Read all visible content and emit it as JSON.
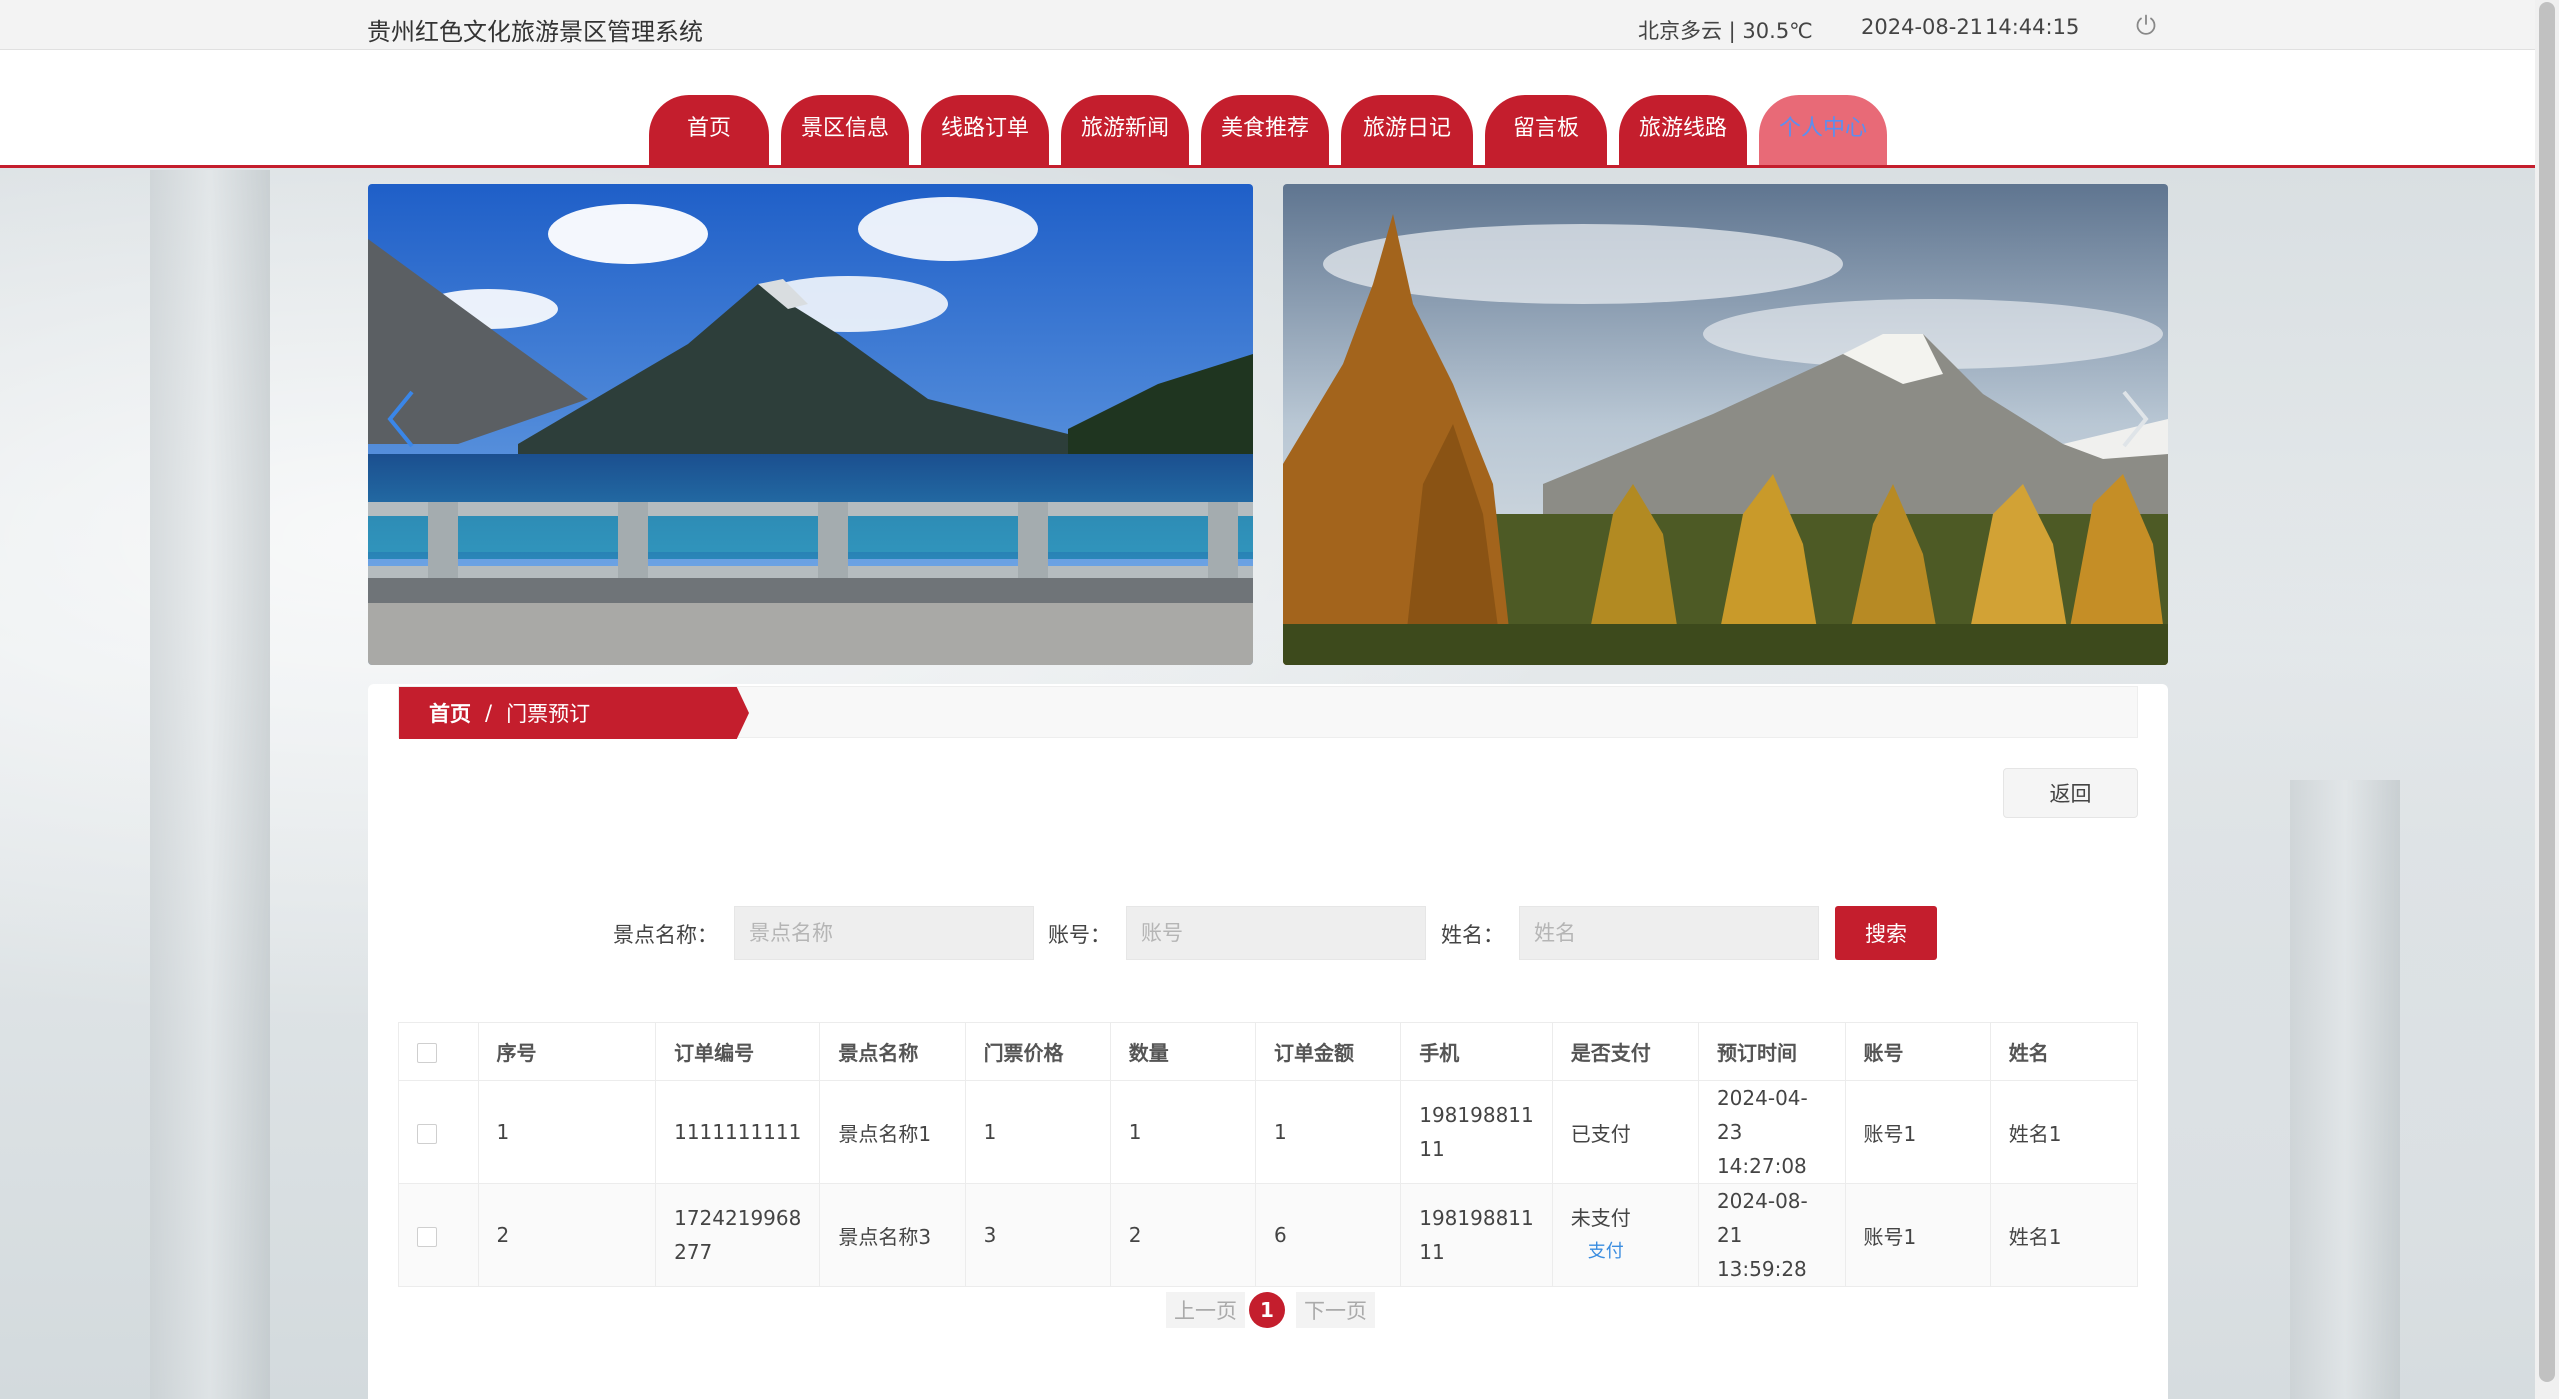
{
  "header": {
    "site_title": "贵州红色文化旅游景区管理系统",
    "weather": "北京多云 | 30.5℃",
    "date": "2024-08-21",
    "time": "14:44:15"
  },
  "nav": {
    "items": [
      "首页",
      "景区信息",
      "线路订单",
      "旅游新闻",
      "美食推荐",
      "旅游日记",
      "留言板",
      "旅游线路",
      "个人中心"
    ],
    "active": "个人中心"
  },
  "breadcrumb": {
    "home": "首页",
    "separator": "/",
    "current": "门票预订"
  },
  "actions": {
    "back_label": "返回"
  },
  "search": {
    "fields": [
      {
        "label": "景点名称：",
        "placeholder": "景点名称"
      },
      {
        "label": "账号：",
        "placeholder": "账号"
      },
      {
        "label": "姓名：",
        "placeholder": "姓名"
      }
    ],
    "button_label": "搜索"
  },
  "table": {
    "columns": [
      "序号",
      "订单编号",
      "景点名称",
      "门票价格",
      "数量",
      "订单金额",
      "手机",
      "是否支付",
      "预订时间",
      "账号",
      "姓名"
    ],
    "rows": [
      {
        "index": "1",
        "order_no_line1": "1111111111",
        "order_no_line2": "",
        "spot_name": "景点名称1",
        "price": "1",
        "quantity": "1",
        "amount": "1",
        "phone_line1": "198198811",
        "phone_line2": "11",
        "paid": "已支付",
        "pay_action": "",
        "time_line1": "2024-04-23",
        "time_line2": "14:27:08",
        "account": "账号1",
        "name": "姓名1"
      },
      {
        "index": "2",
        "order_no_line1": "1724219968",
        "order_no_line2": "277",
        "spot_name": "景点名称3",
        "price": "3",
        "quantity": "2",
        "amount": "6",
        "phone_line1": "198198811",
        "phone_line2": "11",
        "paid": "未支付",
        "pay_action": "支付",
        "time_line1": "2024-08-21",
        "time_line2": "13:59:28",
        "account": "账号1",
        "name": "姓名1"
      }
    ]
  },
  "pagination": {
    "prev_label": "上一页",
    "current_page": "1",
    "next_label": "下一页"
  },
  "colors": {
    "brand_red": "#c41e2d",
    "link_blue": "#3b8de0"
  },
  "icons": {
    "power": "power-icon",
    "prev_slide": "chevron-left-icon",
    "next_slide": "chevron-right-icon"
  }
}
